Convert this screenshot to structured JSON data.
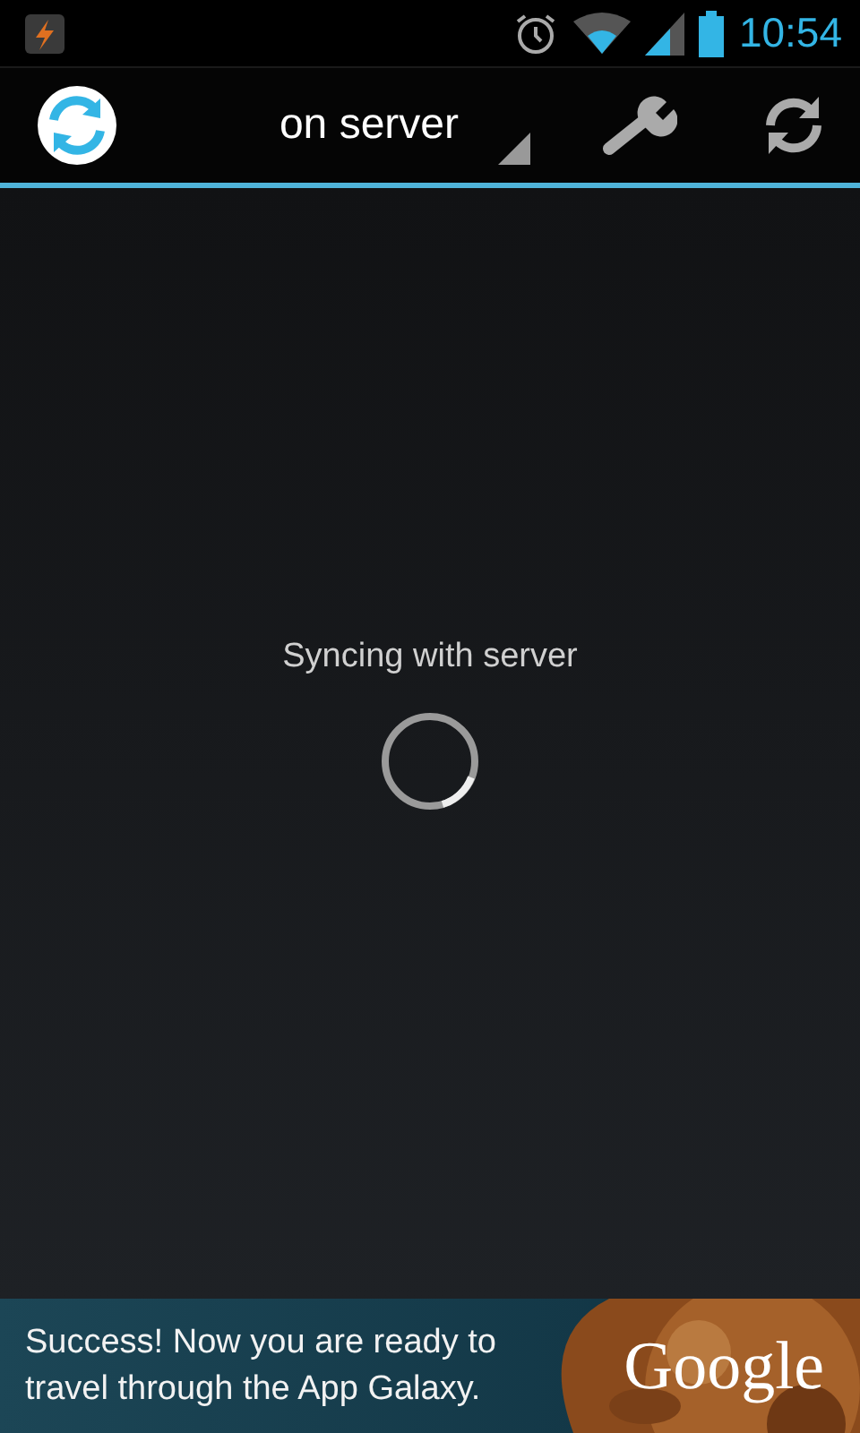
{
  "status_bar": {
    "time": "10:54"
  },
  "action_bar": {
    "title": "on server"
  },
  "content": {
    "message": "Syncing with server"
  },
  "ad_banner": {
    "text": "Success! Now you are ready to travel through the App Galaxy.",
    "brand": "Google"
  }
}
